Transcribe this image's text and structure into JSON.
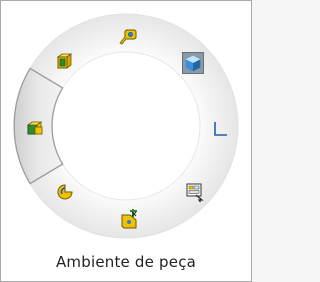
{
  "caption": "Ambiente de peça",
  "gesture_ring": {
    "selected_slot": "left",
    "items": [
      {
        "slot": "top",
        "icon": "measure-tape-icon"
      },
      {
        "slot": "top-right",
        "icon": "isometric-view-cube-icon",
        "highlighted": true
      },
      {
        "slot": "right",
        "icon": "sketch-corner-icon"
      },
      {
        "slot": "bottom-right",
        "icon": "properties-panel-icon"
      },
      {
        "slot": "bottom",
        "icon": "smart-dimension-part-icon"
      },
      {
        "slot": "bottom-left",
        "icon": "revolve-icon"
      },
      {
        "slot": "left",
        "icon": "extrude-boss-icon",
        "selected": true
      },
      {
        "slot": "top-left",
        "icon": "normal-to-view-icon"
      }
    ]
  },
  "colors": {
    "ring_fill": "#f1f1f1",
    "ring_edge": "#dcdcdc",
    "selected_segment": "#dedede",
    "selected_border": "#9c9c9c",
    "highlight_box": "#8a9aa6",
    "icon_yellow": "#f2c200",
    "icon_green": "#2e8b2e",
    "icon_blue": "#2a7fd0"
  }
}
